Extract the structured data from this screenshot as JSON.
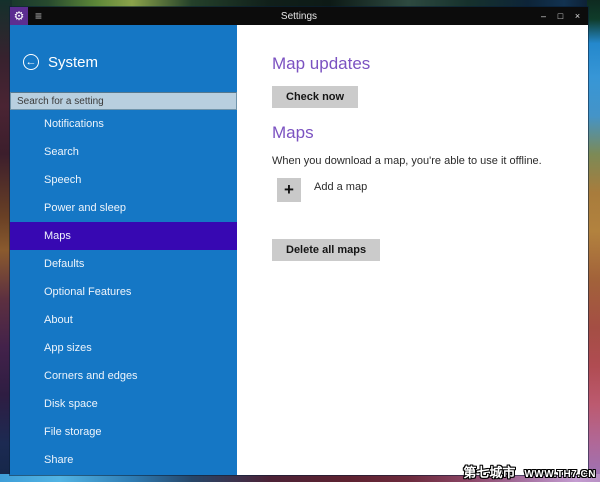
{
  "window": {
    "title": "Settings",
    "caption": {
      "minimize": "–",
      "maximize": "□",
      "close": "×"
    },
    "app_icon_glyph": "⚙",
    "menu_icon_glyph": "≡"
  },
  "sidebar": {
    "title": "System",
    "back_icon_glyph": "←",
    "search_placeholder": "Search for a setting",
    "items": [
      {
        "label": "Notifications",
        "selected": false
      },
      {
        "label": "Search",
        "selected": false
      },
      {
        "label": "Speech",
        "selected": false
      },
      {
        "label": "Power and sleep",
        "selected": false
      },
      {
        "label": "Maps",
        "selected": true
      },
      {
        "label": "Defaults",
        "selected": false
      },
      {
        "label": "Optional Features",
        "selected": false
      },
      {
        "label": "About",
        "selected": false
      },
      {
        "label": "App sizes",
        "selected": false
      },
      {
        "label": "Corners and edges",
        "selected": false
      },
      {
        "label": "Disk space",
        "selected": false
      },
      {
        "label": "File storage",
        "selected": false
      },
      {
        "label": "Share",
        "selected": false
      }
    ]
  },
  "content": {
    "map_updates": {
      "title": "Map updates",
      "check_button": "Check now"
    },
    "maps": {
      "title": "Maps",
      "description": "When you download a map, you're able to use it offline.",
      "add_icon_glyph": "+",
      "add_label": "Add a map",
      "delete_button": "Delete all maps"
    }
  },
  "watermark": {
    "site_name": "第七城市",
    "site_url": "WWW.TH7.CN"
  },
  "colors": {
    "sidebar_blue": "#1577c5",
    "selected_item_purple": "#3708b2",
    "heading_purple": "#7b52c1",
    "titlebar_black": "#0c0c0c",
    "app_icon_purple": "#5c2d91",
    "button_gray": "#cbcbcb",
    "search_bg": "#b8cfdf"
  }
}
